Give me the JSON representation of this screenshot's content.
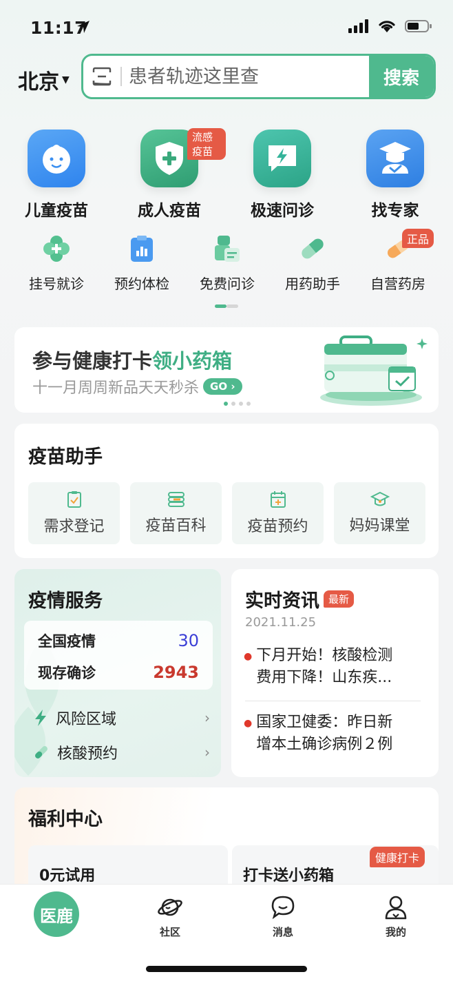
{
  "status": {
    "time": "11:17"
  },
  "header": {
    "city": "北京",
    "search_placeholder": "患者轨迹这里查",
    "search_button": "搜索"
  },
  "big_icons": [
    {
      "label": "儿童疫苗",
      "icon": "baby-face-icon",
      "color": "#3b8ff0"
    },
    {
      "label": "成人疫苗",
      "icon": "shield-plus-icon",
      "color": "#3aa97c",
      "tag": "流感疫苗"
    },
    {
      "label": "极速问诊",
      "icon": "lightning-chat-icon",
      "color": "#35b49a"
    },
    {
      "label": "找专家",
      "icon": "doctor-cap-icon",
      "color": "#3d8fe8"
    }
  ],
  "small_icons": [
    {
      "label": "挂号就诊",
      "icon": "clover-cross-icon"
    },
    {
      "label": "预约体检",
      "icon": "clipboard-chart-icon"
    },
    {
      "label": "免费问诊",
      "icon": "stethoscope-doc-icon"
    },
    {
      "label": "用药助手",
      "icon": "capsule-icon"
    },
    {
      "label": "自营药房",
      "icon": "pill-icon",
      "tag": "正品"
    }
  ],
  "banner": {
    "title_part1": "参与健康打卡",
    "title_part2": "领小药箱",
    "subtitle": "十一月周周新品天天秒杀",
    "go": "GO"
  },
  "vaccine": {
    "title": "疫苗助手",
    "items": [
      {
        "label": "需求登记",
        "icon": "clipboard-check-icon"
      },
      {
        "label": "疫苗百科",
        "icon": "book-stack-icon"
      },
      {
        "label": "疫苗预约",
        "icon": "calendar-plus-icon"
      },
      {
        "label": "妈妈课堂",
        "icon": "graduation-cap-icon"
      }
    ]
  },
  "epidemic": {
    "title": "疫情服务",
    "stats": [
      {
        "label": "全国疫情",
        "value": "30",
        "color": "#3b3fd6"
      },
      {
        "label": "现存确诊",
        "value": "2943",
        "color": "#c9392e"
      }
    ],
    "links": [
      {
        "label": "风险区域",
        "icon": "lightning-icon"
      },
      {
        "label": "核酸预约",
        "icon": "test-tube-icon"
      }
    ]
  },
  "news": {
    "title": "实时资讯",
    "badge": "最新",
    "date": "2021.11.25",
    "items": [
      {
        "line1": "下月开始！核酸检测",
        "line2": "费用下降！山东疾..."
      },
      {
        "line1": "国家卫健委：昨日新",
        "line2": "增本土确诊病例２例"
      }
    ]
  },
  "welfare": {
    "title": "福利中心",
    "cells": [
      {
        "label": "0元试用"
      },
      {
        "label": "打卡送小药箱",
        "tag": "健康打卡"
      }
    ]
  },
  "tabbar": {
    "items": [
      {
        "label": "医鹿",
        "icon": "app-logo-icon"
      },
      {
        "label": "社区",
        "icon": "planet-icon"
      },
      {
        "label": "消息",
        "icon": "chat-bubble-icon"
      },
      {
        "label": "我的",
        "icon": "person-icon"
      }
    ]
  }
}
